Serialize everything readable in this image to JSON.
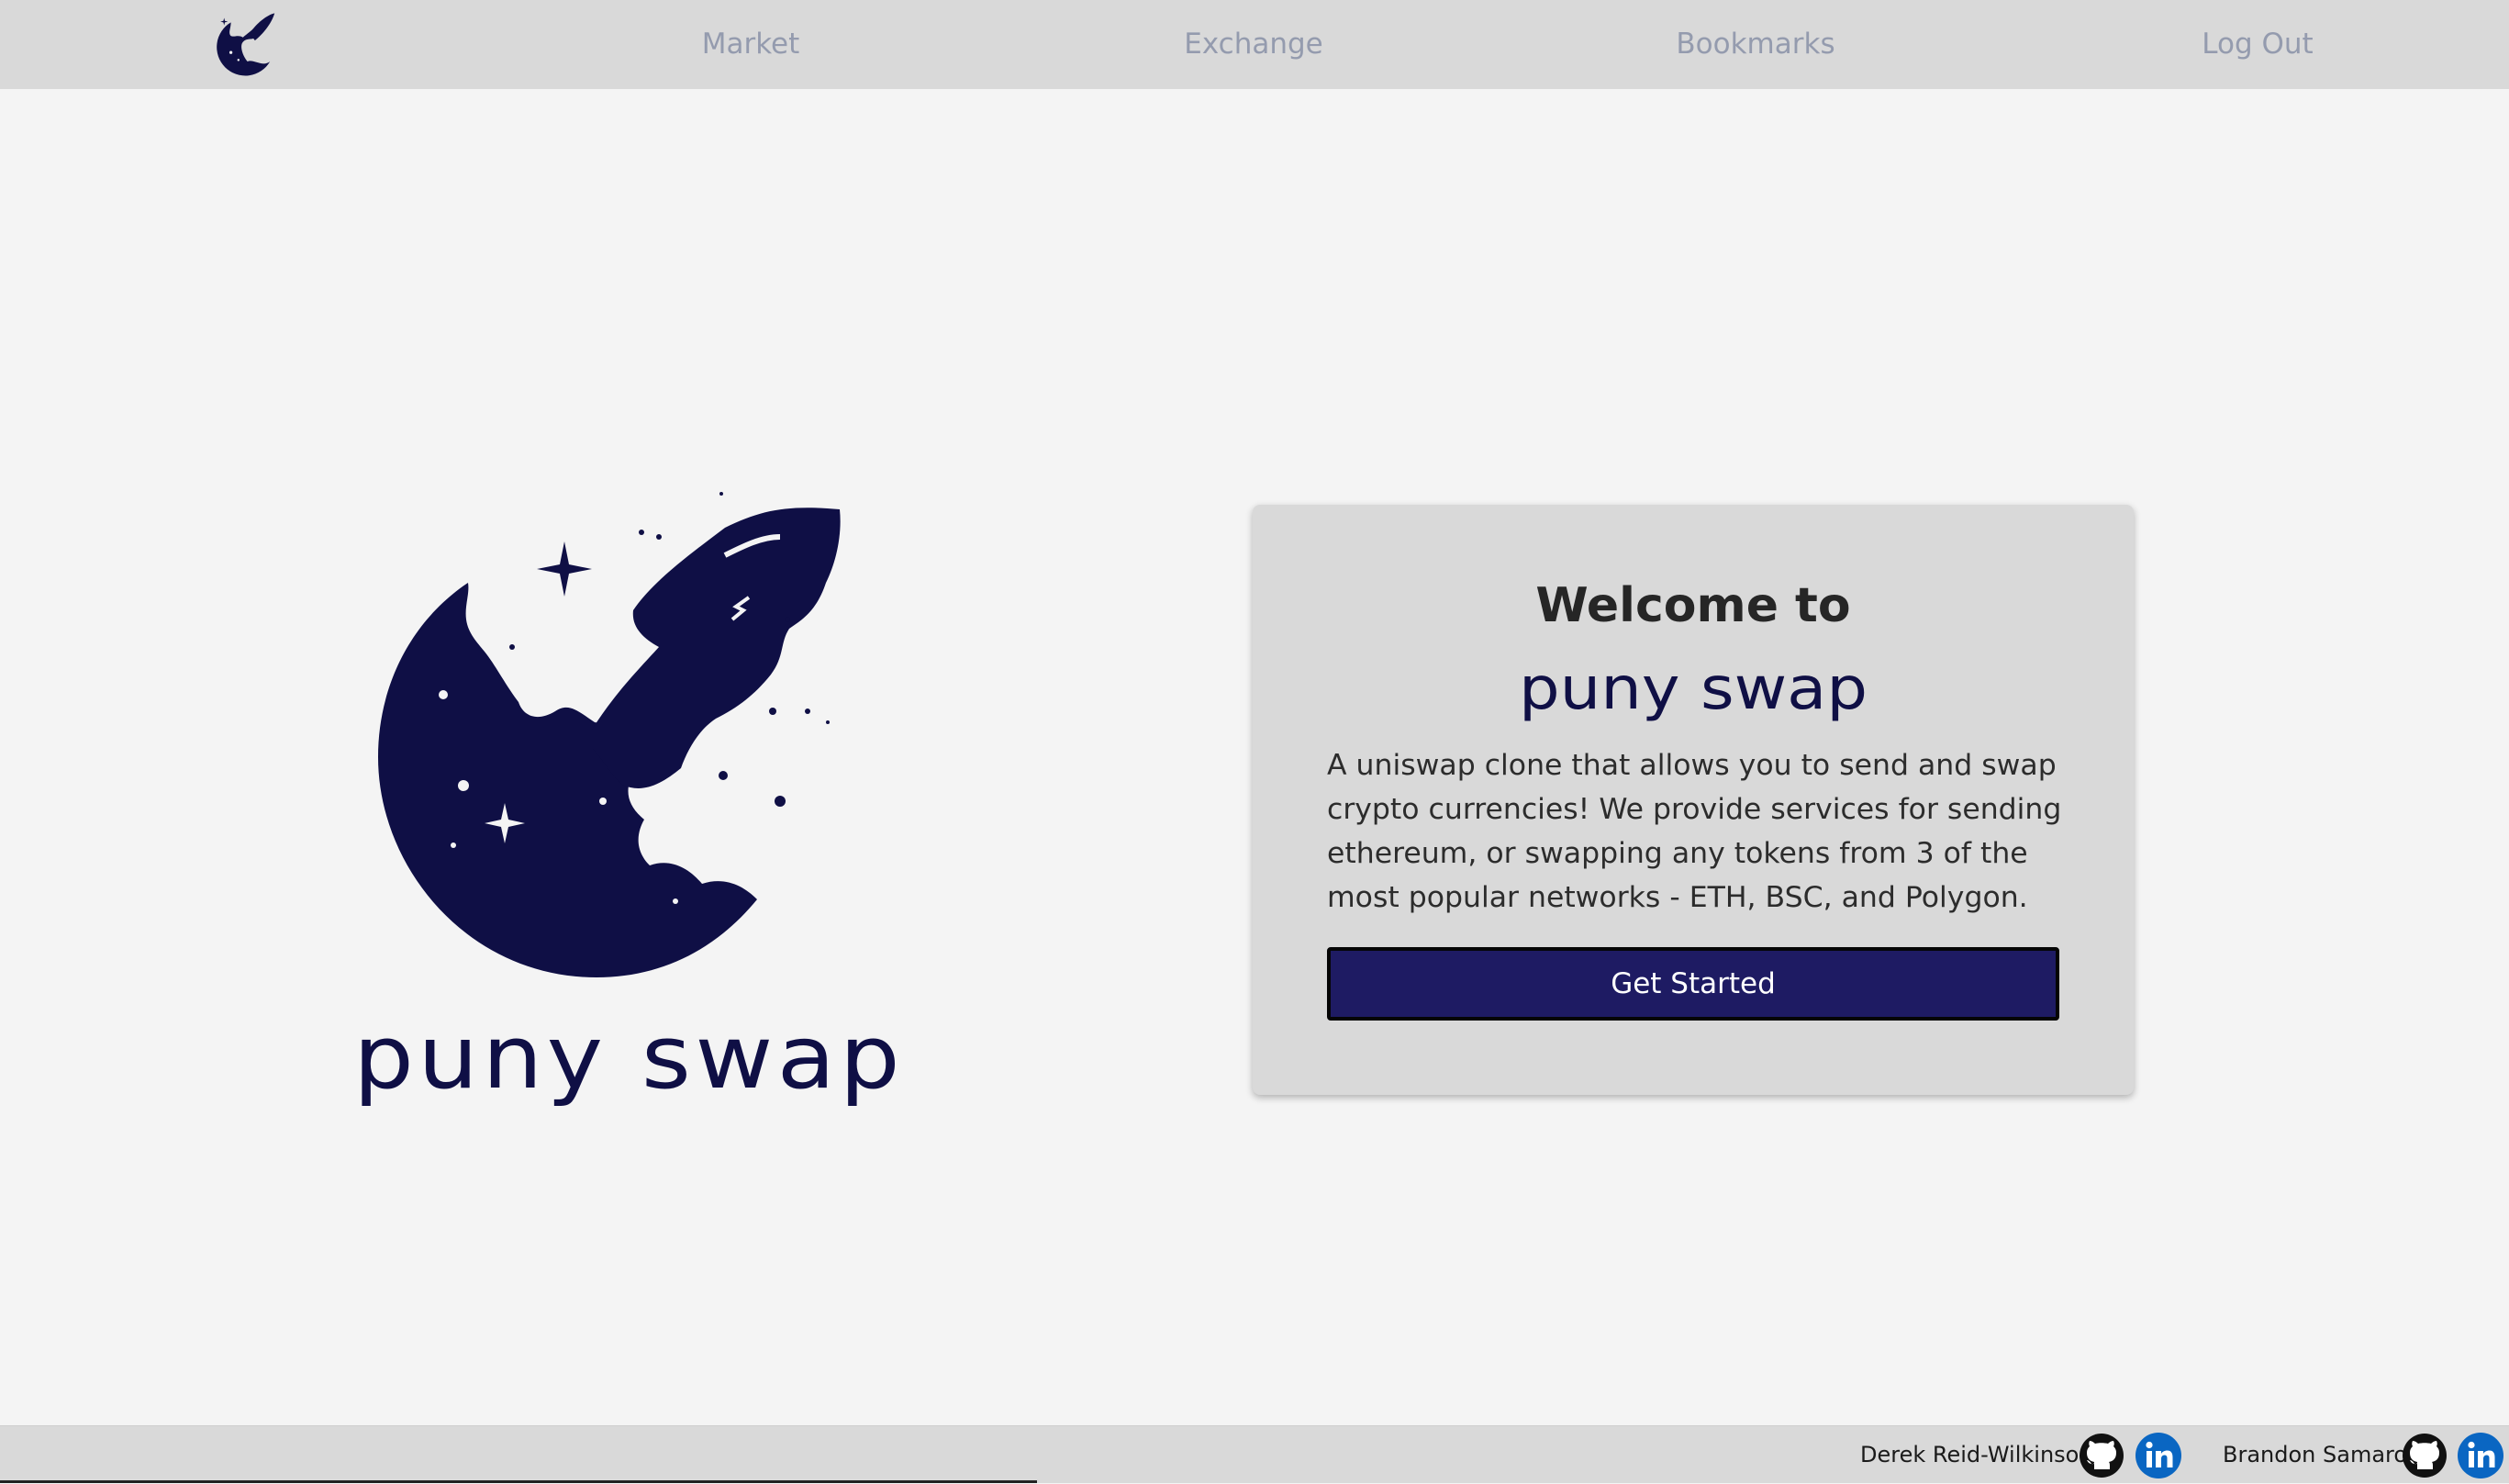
{
  "nav": {
    "links": [
      {
        "label": "Market"
      },
      {
        "label": "Exchange"
      },
      {
        "label": "Bookmarks"
      },
      {
        "label": "Log Out"
      }
    ]
  },
  "hero": {
    "wordmark": "puny swap"
  },
  "card": {
    "title": "Welcome to",
    "brand": "puny swap",
    "description": "A uniswap clone that allows you to send and swap crypto currencies! We provide services for sending ethereum, or swapping any tokens from 3 of the most popular networks - ETH, BSC, and Polygon.",
    "button_label": "Get Started"
  },
  "footer": {
    "authors": [
      {
        "name": "Derek Reid-Wilkinson",
        "icons": [
          "github-icon",
          "linkedin-icon"
        ]
      },
      {
        "name": "Brandon Samaroo",
        "icons": [
          "github-icon",
          "linkedin-icon"
        ]
      }
    ]
  },
  "colors": {
    "navy": "#0f0f45",
    "button": "#1e1b63",
    "nav_bg": "#d9d9d9",
    "page_bg": "#f4f4f4",
    "nav_text": "#949bae",
    "linkedin": "#0a66c2"
  }
}
